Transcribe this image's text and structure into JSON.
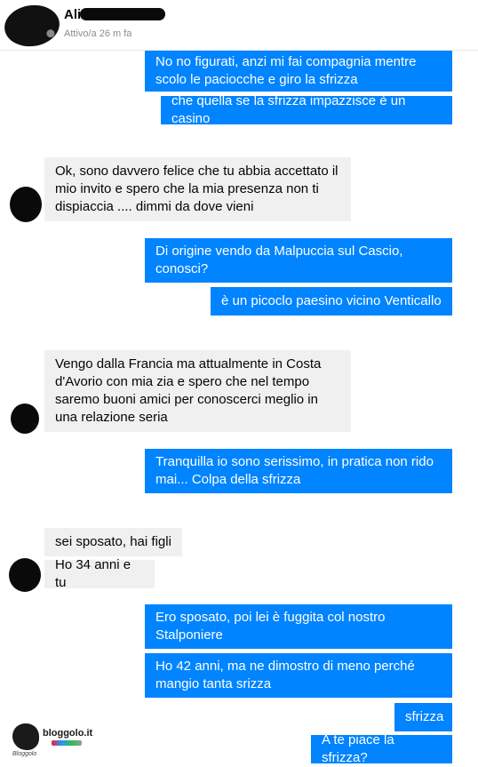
{
  "header": {
    "name": "Ali",
    "status": "Attivo/a 26 m fa"
  },
  "messages": [
    {
      "side": "out",
      "text": "No no figurati, anzi mi fai compagnia mentre scolo le paciocche e giro la sfrizza"
    },
    {
      "side": "out",
      "text": "che quella se la sfrizza impazzisce è un casino"
    },
    {
      "side": "in",
      "text": "Ok, sono davvero felice che tu abbia accettato il mio invito e spero che la mia presenza non ti dispiaccia .... dimmi da dove vieni"
    },
    {
      "side": "out",
      "text": "Di origine vendo da Malpuccia sul Cascio, conosci?"
    },
    {
      "side": "out",
      "text": "è un picoclo paesino vicino Venticallo"
    },
    {
      "side": "in",
      "text": "Vengo dalla Francia ma attualmente in Costa d'Avorio con mia zia e spero che nel tempo saremo buoni amici per conoscerci meglio in una relazione seria"
    },
    {
      "side": "out",
      "text": "Tranquilla io sono serissimo, in pratica non rido mai... Colpa della sfrizza"
    },
    {
      "side": "in",
      "text": "sei sposato, hai figli"
    },
    {
      "side": "in",
      "text": "Ho 34 anni e tu"
    },
    {
      "side": "out",
      "text": "Ero sposato, poi lei è fuggita col nostro Stalponiere"
    },
    {
      "side": "out",
      "text": "Ho 42 anni, ma ne dimostro di meno perché mangio tanta srizza"
    },
    {
      "side": "out",
      "text": "sfrizza"
    },
    {
      "side": "out",
      "text": "A te piace la sfrizza?"
    }
  ],
  "watermark": {
    "brand": "bloggolo.it",
    "tagline": "Bloggolo"
  }
}
